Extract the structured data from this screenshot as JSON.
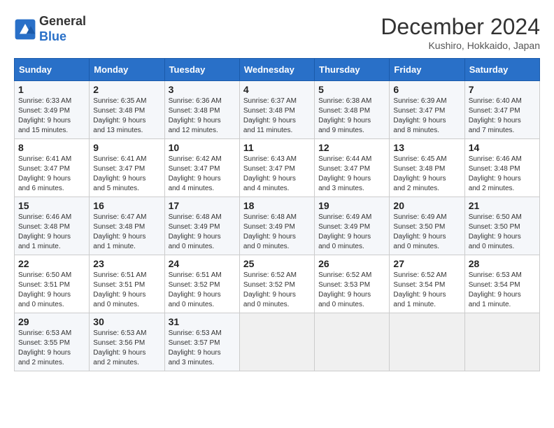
{
  "header": {
    "logo_line1": "General",
    "logo_line2": "Blue",
    "month": "December 2024",
    "location": "Kushiro, Hokkaido, Japan"
  },
  "days_of_week": [
    "Sunday",
    "Monday",
    "Tuesday",
    "Wednesday",
    "Thursday",
    "Friday",
    "Saturday"
  ],
  "weeks": [
    [
      {
        "day": 1,
        "lines": [
          "Sunrise: 6:33 AM",
          "Sunset: 3:49 PM",
          "Daylight: 9 hours",
          "and 15 minutes."
        ]
      },
      {
        "day": 2,
        "lines": [
          "Sunrise: 6:35 AM",
          "Sunset: 3:48 PM",
          "Daylight: 9 hours",
          "and 13 minutes."
        ]
      },
      {
        "day": 3,
        "lines": [
          "Sunrise: 6:36 AM",
          "Sunset: 3:48 PM",
          "Daylight: 9 hours",
          "and 12 minutes."
        ]
      },
      {
        "day": 4,
        "lines": [
          "Sunrise: 6:37 AM",
          "Sunset: 3:48 PM",
          "Daylight: 9 hours",
          "and 11 minutes."
        ]
      },
      {
        "day": 5,
        "lines": [
          "Sunrise: 6:38 AM",
          "Sunset: 3:48 PM",
          "Daylight: 9 hours",
          "and 9 minutes."
        ]
      },
      {
        "day": 6,
        "lines": [
          "Sunrise: 6:39 AM",
          "Sunset: 3:47 PM",
          "Daylight: 9 hours",
          "and 8 minutes."
        ]
      },
      {
        "day": 7,
        "lines": [
          "Sunrise: 6:40 AM",
          "Sunset: 3:47 PM",
          "Daylight: 9 hours",
          "and 7 minutes."
        ]
      }
    ],
    [
      {
        "day": 8,
        "lines": [
          "Sunrise: 6:41 AM",
          "Sunset: 3:47 PM",
          "Daylight: 9 hours",
          "and 6 minutes."
        ]
      },
      {
        "day": 9,
        "lines": [
          "Sunrise: 6:41 AM",
          "Sunset: 3:47 PM",
          "Daylight: 9 hours",
          "and 5 minutes."
        ]
      },
      {
        "day": 10,
        "lines": [
          "Sunrise: 6:42 AM",
          "Sunset: 3:47 PM",
          "Daylight: 9 hours",
          "and 4 minutes."
        ]
      },
      {
        "day": 11,
        "lines": [
          "Sunrise: 6:43 AM",
          "Sunset: 3:47 PM",
          "Daylight: 9 hours",
          "and 4 minutes."
        ]
      },
      {
        "day": 12,
        "lines": [
          "Sunrise: 6:44 AM",
          "Sunset: 3:47 PM",
          "Daylight: 9 hours",
          "and 3 minutes."
        ]
      },
      {
        "day": 13,
        "lines": [
          "Sunrise: 6:45 AM",
          "Sunset: 3:48 PM",
          "Daylight: 9 hours",
          "and 2 minutes."
        ]
      },
      {
        "day": 14,
        "lines": [
          "Sunrise: 6:46 AM",
          "Sunset: 3:48 PM",
          "Daylight: 9 hours",
          "and 2 minutes."
        ]
      }
    ],
    [
      {
        "day": 15,
        "lines": [
          "Sunrise: 6:46 AM",
          "Sunset: 3:48 PM",
          "Daylight: 9 hours",
          "and 1 minute."
        ]
      },
      {
        "day": 16,
        "lines": [
          "Sunrise: 6:47 AM",
          "Sunset: 3:48 PM",
          "Daylight: 9 hours",
          "and 1 minute."
        ]
      },
      {
        "day": 17,
        "lines": [
          "Sunrise: 6:48 AM",
          "Sunset: 3:49 PM",
          "Daylight: 9 hours",
          "and 0 minutes."
        ]
      },
      {
        "day": 18,
        "lines": [
          "Sunrise: 6:48 AM",
          "Sunset: 3:49 PM",
          "Daylight: 9 hours",
          "and 0 minutes."
        ]
      },
      {
        "day": 19,
        "lines": [
          "Sunrise: 6:49 AM",
          "Sunset: 3:49 PM",
          "Daylight: 9 hours",
          "and 0 minutes."
        ]
      },
      {
        "day": 20,
        "lines": [
          "Sunrise: 6:49 AM",
          "Sunset: 3:50 PM",
          "Daylight: 9 hours",
          "and 0 minutes."
        ]
      },
      {
        "day": 21,
        "lines": [
          "Sunrise: 6:50 AM",
          "Sunset: 3:50 PM",
          "Daylight: 9 hours",
          "and 0 minutes."
        ]
      }
    ],
    [
      {
        "day": 22,
        "lines": [
          "Sunrise: 6:50 AM",
          "Sunset: 3:51 PM",
          "Daylight: 9 hours",
          "and 0 minutes."
        ]
      },
      {
        "day": 23,
        "lines": [
          "Sunrise: 6:51 AM",
          "Sunset: 3:51 PM",
          "Daylight: 9 hours",
          "and 0 minutes."
        ]
      },
      {
        "day": 24,
        "lines": [
          "Sunrise: 6:51 AM",
          "Sunset: 3:52 PM",
          "Daylight: 9 hours",
          "and 0 minutes."
        ]
      },
      {
        "day": 25,
        "lines": [
          "Sunrise: 6:52 AM",
          "Sunset: 3:52 PM",
          "Daylight: 9 hours",
          "and 0 minutes."
        ]
      },
      {
        "day": 26,
        "lines": [
          "Sunrise: 6:52 AM",
          "Sunset: 3:53 PM",
          "Daylight: 9 hours",
          "and 0 minutes."
        ]
      },
      {
        "day": 27,
        "lines": [
          "Sunrise: 6:52 AM",
          "Sunset: 3:54 PM",
          "Daylight: 9 hours",
          "and 1 minute."
        ]
      },
      {
        "day": 28,
        "lines": [
          "Sunrise: 6:53 AM",
          "Sunset: 3:54 PM",
          "Daylight: 9 hours",
          "and 1 minute."
        ]
      }
    ],
    [
      {
        "day": 29,
        "lines": [
          "Sunrise: 6:53 AM",
          "Sunset: 3:55 PM",
          "Daylight: 9 hours",
          "and 2 minutes."
        ]
      },
      {
        "day": 30,
        "lines": [
          "Sunrise: 6:53 AM",
          "Sunset: 3:56 PM",
          "Daylight: 9 hours",
          "and 2 minutes."
        ]
      },
      {
        "day": 31,
        "lines": [
          "Sunrise: 6:53 AM",
          "Sunset: 3:57 PM",
          "Daylight: 9 hours",
          "and 3 minutes."
        ]
      },
      null,
      null,
      null,
      null
    ]
  ]
}
